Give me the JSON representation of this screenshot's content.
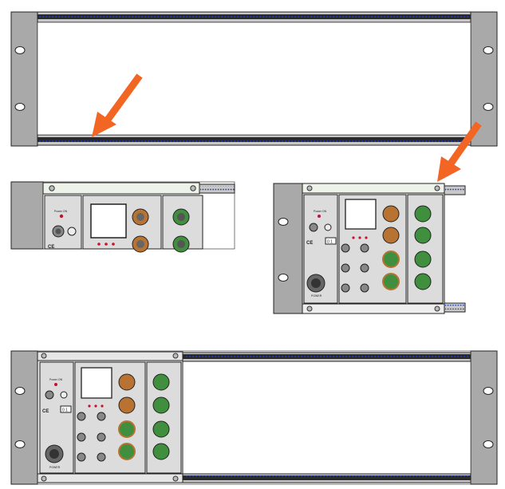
{
  "colors": {
    "background": "#ffffff",
    "ear": "#a9a9a9",
    "rail": "#c8c8c8",
    "rail_dots": "#1e3aa8",
    "arrow": "#f26522",
    "module_panel": "#dcdcdc",
    "copper": "#b87333",
    "green_connector": "#3f8f3f",
    "led": "#c8102e"
  },
  "icons": {
    "arrow": "orange-arrow-icon",
    "screw": "screw-icon",
    "hole": "mounting-hole-icon",
    "led": "led-icon",
    "connector": "circular-connector-icon",
    "bnc": "bnc-connector-icon"
  },
  "labels": {
    "power_on": "Power ON",
    "ce_mark": "CE",
    "tuv_mark": "0 1",
    "power_connector": "POWER"
  }
}
